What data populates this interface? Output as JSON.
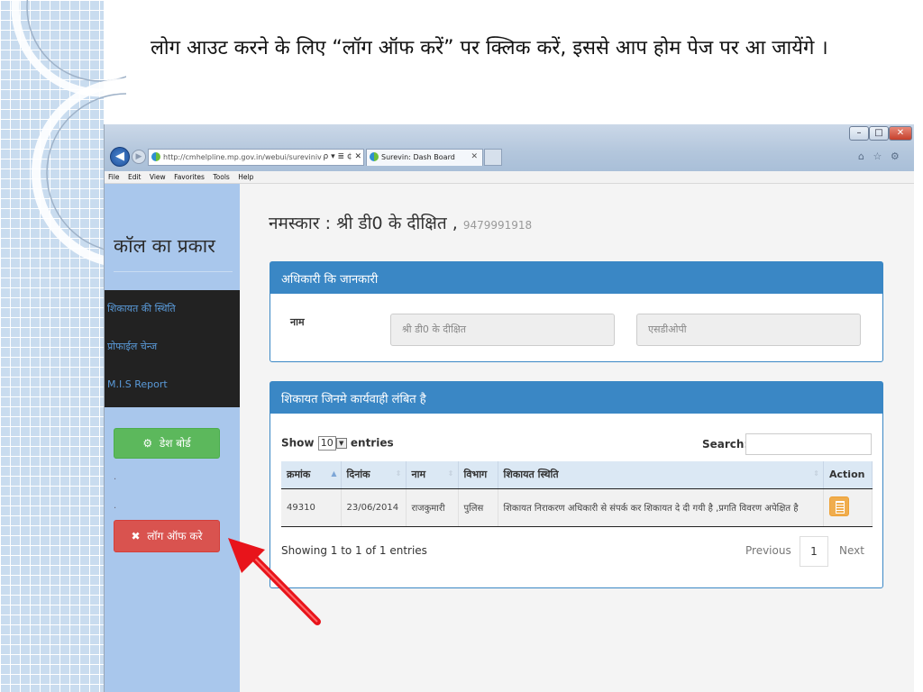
{
  "slide": {
    "caption": "लोग आउट करने के लिए “लॉग ऑफ करें” पर क्लिक करें, इससे आप होम पेज पर आ जायेंगे ।"
  },
  "browser": {
    "address_url": "http://cmhelpline.mp.gov.in/webui/sureviniv2/c",
    "address_controls": "ρ ▾ ≣ ¢ ✕",
    "tab_title": "Surevin: Dash Board",
    "tab_close": "✕",
    "window_buttons": {
      "minimize": "–",
      "maximize": "□",
      "close": "✕"
    },
    "toolbar_icons": "⌂ ☆ ⚙",
    "menu": [
      "File",
      "Edit",
      "View",
      "Favorites",
      "Tools",
      "Help"
    ]
  },
  "sidebar": {
    "title": "कॉल का प्रकार",
    "links": [
      "शिकायत की स्थिति",
      "प्रोफाईल चेन्ज",
      "M.I.S Report"
    ],
    "dash_button": "डेश बोर्ड",
    "dash_icon": "⚙",
    "dots": [
      ".",
      "."
    ],
    "logoff_button": "लॉग ऑफ करे",
    "logoff_icon": "✖"
  },
  "main": {
    "greeting": "नमस्कार : श्री डी0 के दीक्षित ,",
    "phone": "9479991918",
    "officer_panel": {
      "heading": "अधिकारी कि जानकारी",
      "name_label": "नाम",
      "name_value": "श्री डी0 के दीक्षित",
      "post_value": "एसडीओपी"
    },
    "complaints_panel": {
      "heading": "शिकायत जिनमे कार्यवाही लंबित है",
      "show_label": "Show",
      "show_value": "10",
      "entries_label": "entries",
      "search_label": "Search:",
      "columns": [
        "क्रमांक",
        "दिनांक",
        "नाम",
        "विभाग",
        "शिकायत स्थिति",
        "Action"
      ],
      "rows": [
        [
          "49310",
          "23/06/2014",
          "राजकुमारी",
          "पुलिस",
          "शिकायत निराकरण अधिकारी से संपर्क कर शिकायत दे दी गयी है ,प्रगति विवरण अपेक्षित है"
        ]
      ],
      "info": "Showing 1 to 1 of 1 entries",
      "previous": "Previous",
      "page": "1",
      "next": "Next"
    }
  },
  "colors": {
    "panel_blue": "#3a87c5",
    "success_green": "#5cb85c",
    "danger_red": "#d9534f",
    "warning_orange": "#f0ad4e",
    "sidebar_blue": "#a9c7ec",
    "arrow_red": "#e8141b"
  }
}
